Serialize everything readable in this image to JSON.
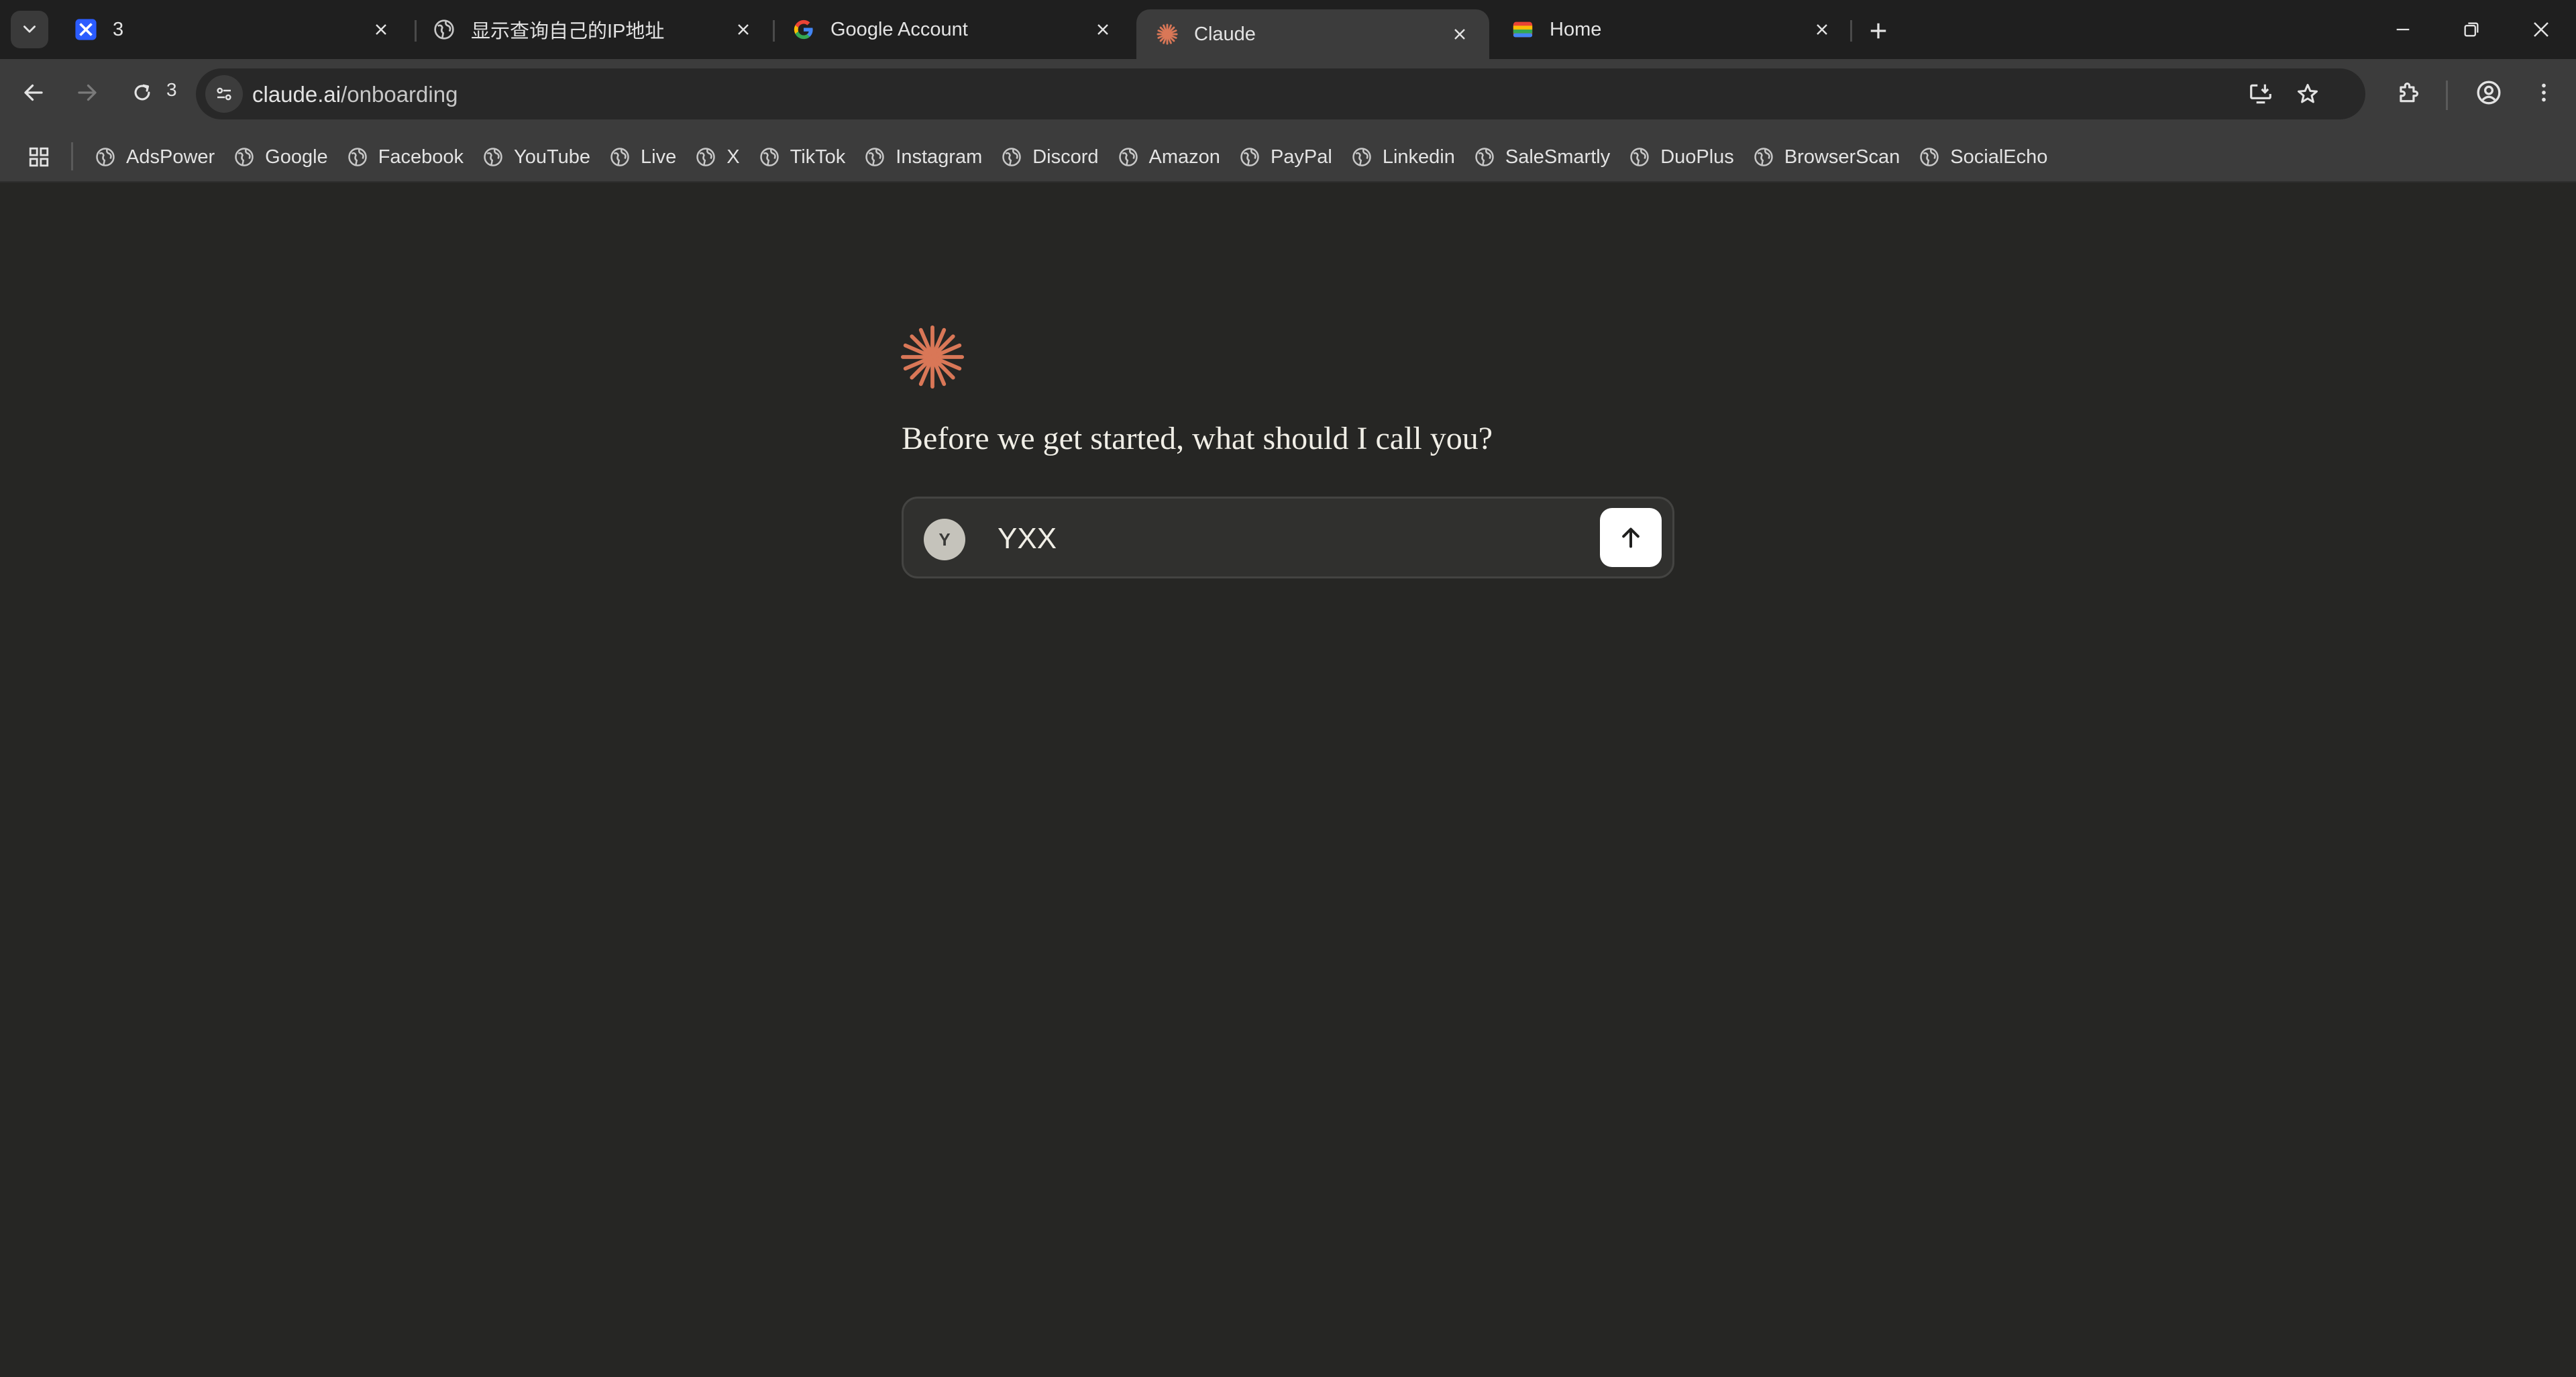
{
  "browser": {
    "tabs": [
      {
        "title": "3",
        "icon": "adspower-icon",
        "active": false
      },
      {
        "title": "显示查询自己的IP地址",
        "icon": "globe-icon",
        "active": false
      },
      {
        "title": "Google Account",
        "icon": "google-icon",
        "active": false
      },
      {
        "title": "Claude",
        "icon": "claude-icon",
        "active": true
      },
      {
        "title": "Home",
        "icon": "home-colorful-icon",
        "active": false
      }
    ],
    "toolbar": {
      "tab_count": "3",
      "url_host": "claude.ai",
      "url_path": "/onboarding"
    },
    "bookmarks": [
      "AdsPower",
      "Google",
      "Facebook",
      "YouTube",
      "Live",
      "X",
      "TikTok",
      "Instagram",
      "Discord",
      "Amazon",
      "PayPal",
      "Linkedin",
      "SaleSmartly",
      "DuoPlus",
      "BrowserScan",
      "SocialEcho"
    ]
  },
  "onboarding": {
    "prompt": "Before we get started, what should I call you?",
    "avatar_letter": "Y",
    "name_value": "YXX"
  },
  "colors": {
    "claude_accent": "#d97757",
    "page_bg": "#262624",
    "toolbar_bg": "#3c3c3c",
    "tabstrip_bg": "#1f1f1f"
  }
}
